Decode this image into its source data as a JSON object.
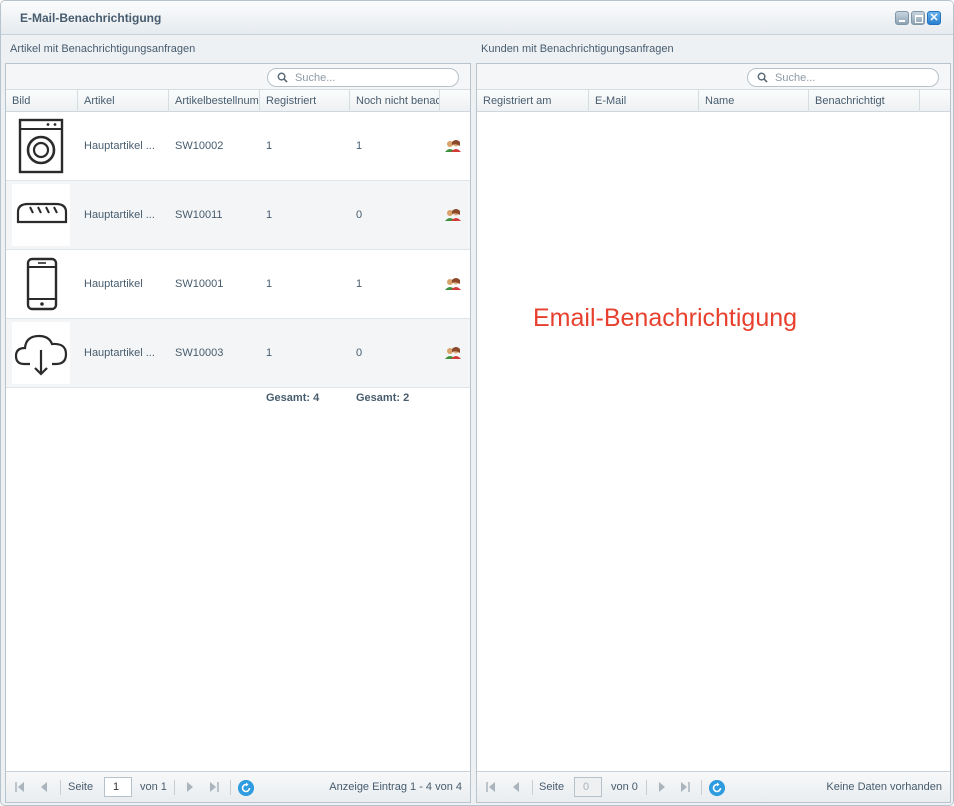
{
  "window": {
    "title": "E-Mail-Benachrichtigung",
    "buttons": [
      "minimize-icon",
      "maximize-icon",
      "close-icon"
    ]
  },
  "left_panel": {
    "title": "Artikel mit Benachrichtigungsanfragen",
    "search_placeholder": "Suche...",
    "columns": [
      "Bild",
      "Artikel",
      "Artikelbestellnum",
      "Registriert",
      "Noch nicht benac"
    ],
    "rows": [
      {
        "image": "washing-machine-icon",
        "article": "Hauptartikel ...",
        "order_number": "SW10002",
        "registered": "1",
        "not_notified": "1"
      },
      {
        "image": "bread-icon",
        "article": "Hauptartikel ...",
        "order_number": "SW10011",
        "registered": "1",
        "not_notified": "0"
      },
      {
        "image": "smartphone-icon",
        "article": "Hauptartikel",
        "order_number": "SW10001",
        "registered": "1",
        "not_notified": "1"
      },
      {
        "image": "cloud-download-icon",
        "article": "Hauptartikel ...",
        "order_number": "SW10003",
        "registered": "1",
        "not_notified": "0"
      }
    ],
    "totals": {
      "registered": "Gesamt: 4",
      "not_notified": "Gesamt: 2"
    },
    "pager": {
      "page_label": "Seite",
      "page_value": "1",
      "of_label": "von 1",
      "info": "Anzeige Eintrag 1 - 4 von 4"
    }
  },
  "right_panel": {
    "title": "Kunden mit Benachrichtigungsanfragen",
    "search_placeholder": "Suche...",
    "columns": [
      "Registriert am",
      "E-Mail",
      "Name",
      "Benachrichtigt"
    ],
    "annotation": "Email-Benachrichtigung",
    "pager": {
      "page_label": "Seite",
      "page_value": "0",
      "of_label": "von 0",
      "info": "Keine Daten vorhanden"
    }
  },
  "colors": {
    "accent": "#2f9ce0",
    "annotation": "#e8402e",
    "text": "#475c6e"
  }
}
